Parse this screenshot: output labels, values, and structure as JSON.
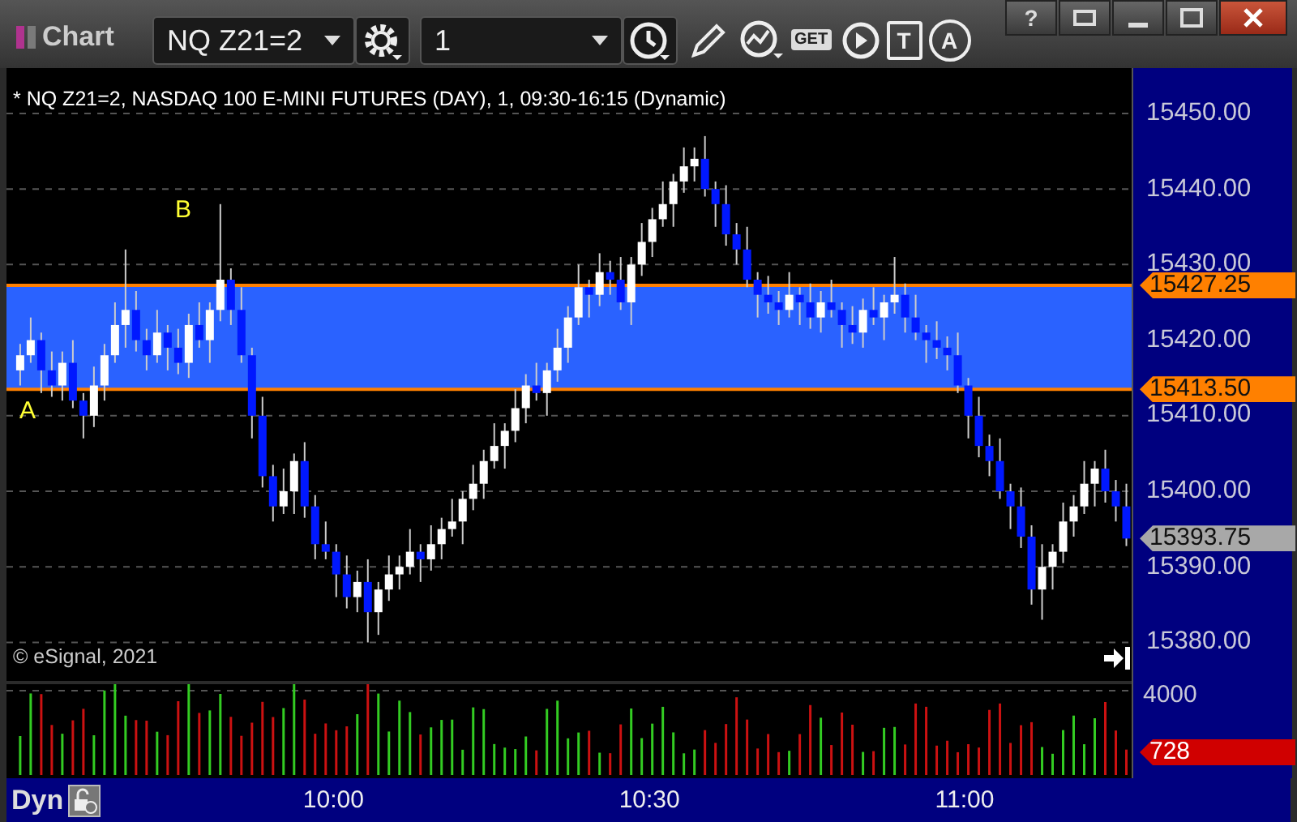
{
  "window": {
    "title": "Chart",
    "help_label": "?"
  },
  "toolbar": {
    "symbol": "NQ Z21=2",
    "interval": "1",
    "get_label": "GET",
    "text_tool_label": "T",
    "annotation_label": "A"
  },
  "chart": {
    "header": "* NQ Z21=2, NASDAQ 100 E-MINI FUTURES (DAY), 1, 09:30-16:15 (Dynamic)",
    "point_labels": [
      "B",
      "A"
    ],
    "copyright": "© eSignal, 2021",
    "price_markers": [
      {
        "label": "15427.25",
        "color": "#ff8000"
      },
      {
        "label": "15413.50",
        "color": "#ff8000"
      },
      {
        "label": "15393.75",
        "color": "#a8a8a8"
      }
    ],
    "volume_tick": "4000",
    "volume_marker": {
      "label": "728",
      "color": "#d00000"
    },
    "chart_data": {
      "type": "candlestick",
      "categories": [
        null,
        null,
        null,
        null,
        null,
        null,
        null,
        null,
        null,
        null,
        null,
        null,
        null,
        null,
        null,
        null,
        null,
        null,
        null,
        null,
        null,
        null,
        null,
        null,
        null,
        null,
        null,
        null,
        null,
        null,
        "10:00",
        null,
        null,
        null,
        null,
        null,
        null,
        null,
        null,
        null,
        null,
        null,
        null,
        null,
        null,
        null,
        null,
        null,
        null,
        null,
        null,
        null,
        null,
        null,
        null,
        null,
        null,
        null,
        null,
        null,
        "10:30",
        null,
        null,
        null,
        null,
        null,
        null,
        null,
        null,
        null,
        null,
        null,
        null,
        null,
        null,
        null,
        null,
        null,
        null,
        null,
        null,
        null,
        null,
        null,
        null,
        null,
        null,
        null,
        null,
        null,
        "11:00",
        null,
        null,
        null,
        null,
        null,
        null,
        null,
        null,
        null,
        null,
        null,
        null,
        null,
        null,
        null
      ],
      "ylim": [
        15361.6,
        15456
      ],
      "ref_lines": [
        {
          "axis": "y",
          "value": 15427.25,
          "color": "#ff8000"
        },
        {
          "axis": "y",
          "value": 15413.5,
          "color": "#ff8000"
        }
      ],
      "bands": [
        {
          "axis": "y",
          "from": 15413.5,
          "to": 15427.25,
          "color": "#2a62ff"
        }
      ],
      "ohlc": [
        [
          15416,
          15419.5,
          15414,
          15418
        ],
        [
          15418,
          15423,
          15417,
          15420
        ],
        [
          15420,
          15421,
          15413,
          15416
        ],
        [
          15416,
          15418.5,
          15412.5,
          15414
        ],
        [
          15414,
          15418.5,
          15412,
          15417
        ],
        [
          15417,
          15420,
          15411,
          15412
        ],
        [
          15412,
          15413,
          15407,
          15410
        ],
        [
          15410,
          15416.5,
          15408.5,
          15414
        ],
        [
          15414,
          15419.5,
          15412,
          15418
        ],
        [
          15418,
          15425,
          15417,
          15422
        ],
        [
          15422,
          15432,
          15419,
          15424
        ],
        [
          15424,
          15426.5,
          15418.5,
          15420
        ],
        [
          15420,
          15421.5,
          15416,
          15418
        ],
        [
          15418,
          15424,
          15417,
          15421
        ],
        [
          15421,
          15422,
          15416,
          15419
        ],
        [
          15419,
          15421.5,
          15415.5,
          15417
        ],
        [
          15417,
          15423.5,
          15415,
          15422
        ],
        [
          15422,
          15425,
          15419,
          15420
        ],
        [
          15420,
          15425,
          15417,
          15424
        ],
        [
          15424,
          15438,
          15422.5,
          15428
        ],
        [
          15428,
          15429.5,
          15422,
          15424
        ],
        [
          15424,
          15427,
          15417,
          15418
        ],
        [
          15418,
          15419,
          15407,
          15410
        ],
        [
          15410,
          15412.5,
          15400.5,
          15402
        ],
        [
          15402,
          15403.5,
          15396,
          15398
        ],
        [
          15398,
          15403,
          15397,
          15400
        ],
        [
          15400,
          15405,
          15397,
          15404
        ],
        [
          15404,
          15406.5,
          15396.5,
          15398
        ],
        [
          15398,
          15399.5,
          15391,
          15393
        ],
        [
          15393,
          15396,
          15391,
          15392
        ],
        [
          15392,
          15393,
          15386,
          15389
        ],
        [
          15389,
          15391.5,
          15384.5,
          15386
        ],
        [
          15386,
          15389.5,
          15384,
          15388
        ],
        [
          15388,
          15391,
          15380,
          15384
        ],
        [
          15384,
          15388,
          15381,
          15387
        ],
        [
          15387,
          15391.5,
          15385.5,
          15389
        ],
        [
          15389,
          15391.5,
          15387,
          15390
        ],
        [
          15390,
          15395,
          15389,
          15392
        ],
        [
          15392,
          15393,
          15388,
          15391
        ],
        [
          15391,
          15395.5,
          15389.5,
          15393
        ],
        [
          15393,
          15396.5,
          15391,
          15395
        ],
        [
          15395,
          15399,
          15394,
          15396
        ],
        [
          15396,
          15400,
          15393,
          15399
        ],
        [
          15399,
          15403.5,
          15397.5,
          15401
        ],
        [
          15401,
          15405.5,
          15399,
          15404
        ],
        [
          15404,
          15409,
          15403,
          15406
        ],
        [
          15406,
          15409,
          15403,
          15408
        ],
        [
          15408,
          15413.5,
          15406.5,
          15411
        ],
        [
          15411,
          15415.5,
          15409,
          15414
        ],
        [
          15414,
          15417,
          15412,
          15413
        ],
        [
          15413,
          15417,
          15410,
          15416
        ],
        [
          15416,
          15421.5,
          15414.5,
          15419
        ],
        [
          15419,
          15424.5,
          15417,
          15423
        ],
        [
          15423,
          15430,
          15422,
          15427
        ],
        [
          15427,
          15428,
          15423,
          15426
        ],
        [
          15426,
          15431.5,
          15424.5,
          15429
        ],
        [
          15429,
          15430.5,
          15426,
          15428
        ],
        [
          15428,
          15431,
          15424,
          15425
        ],
        [
          15425,
          15431,
          15422,
          15430
        ],
        [
          15430,
          15435.5,
          15428.5,
          15433
        ],
        [
          15433,
          15437.5,
          15431,
          15436
        ],
        [
          15436,
          15441,
          15435,
          15438
        ],
        [
          15438,
          15442,
          15435,
          15441
        ],
        [
          15441,
          15445.5,
          15439.5,
          15443
        ],
        [
          15443,
          15445.5,
          15441,
          15444
        ],
        [
          15444,
          15447,
          15439,
          15440
        ],
        [
          15440,
          15441,
          15435,
          15438
        ],
        [
          15438,
          15440.5,
          15432.5,
          15434
        ],
        [
          15434,
          15435.5,
          15430,
          15432
        ],
        [
          15432,
          15435,
          15427,
          15428
        ],
        [
          15428,
          15429,
          15423,
          15426
        ],
        [
          15426,
          15428.5,
          15423.5,
          15425
        ],
        [
          15425,
          15426.5,
          15422,
          15424
        ],
        [
          15424,
          15429,
          15423,
          15426
        ],
        [
          15426,
          15427,
          15422,
          15425
        ],
        [
          15425,
          15427.5,
          15421.5,
          15423
        ],
        [
          15423,
          15426.5,
          15421,
          15425
        ],
        [
          15425,
          15428,
          15423,
          15424
        ],
        [
          15424,
          15425,
          15419,
          15422
        ],
        [
          15422,
          15424.5,
          15419.5,
          15421
        ],
        [
          15421,
          15425.5,
          15419,
          15424
        ],
        [
          15424,
          15427,
          15422,
          15423
        ],
        [
          15423,
          15426,
          15420,
          15425
        ],
        [
          15425,
          15431,
          15423.5,
          15426
        ],
        [
          15426,
          15427.5,
          15421,
          15423
        ],
        [
          15423,
          15426,
          15420,
          15421
        ],
        [
          15421,
          15422,
          15417,
          15420
        ],
        [
          15420,
          15422.5,
          15417.5,
          15419
        ],
        [
          15419,
          15420.5,
          15416,
          15418
        ],
        [
          15418,
          15421,
          15413,
          15414
        ],
        [
          15414,
          15415,
          15407,
          15410
        ],
        [
          15410,
          15412.5,
          15404.5,
          15406
        ],
        [
          15406,
          15407.5,
          15402,
          15404
        ],
        [
          15404,
          15407,
          15399,
          15400
        ],
        [
          15400,
          15401,
          15395,
          15398
        ],
        [
          15398,
          15400.5,
          15392.5,
          15394
        ],
        [
          15394,
          15395.5,
          15385,
          15387
        ],
        [
          15387,
          15393,
          15383,
          15390
        ],
        [
          15390,
          15393,
          15387,
          15392
        ],
        [
          15392,
          15398.5,
          15390.5,
          15396
        ],
        [
          15396,
          15399.5,
          15394,
          15398
        ],
        [
          15398,
          15404,
          15397,
          15401
        ],
        [
          15401,
          15404,
          15398,
          15403
        ],
        [
          15403,
          15405.5,
          15398.5,
          15400
        ],
        [
          15400,
          15401.5,
          15396,
          15398
        ],
        [
          15398,
          15401,
          15392.75,
          15393.75
        ]
      ],
      "yticks": [
        {
          "value": 15450,
          "label": "15450.00"
        },
        {
          "value": 15440,
          "label": "15440.00"
        },
        {
          "value": 15430,
          "label": "15430.00"
        },
        {
          "value": 15420,
          "label": "15420.00"
        },
        {
          "value": 15410,
          "label": "15410.00"
        },
        {
          "value": 15400,
          "label": "15400.00"
        },
        {
          "value": 15390,
          "label": "15390.00"
        },
        {
          "value": 15380,
          "label": "15380.00"
        }
      ],
      "grid": true
    }
  },
  "time_axis": {
    "mode": "Dyn"
  }
}
